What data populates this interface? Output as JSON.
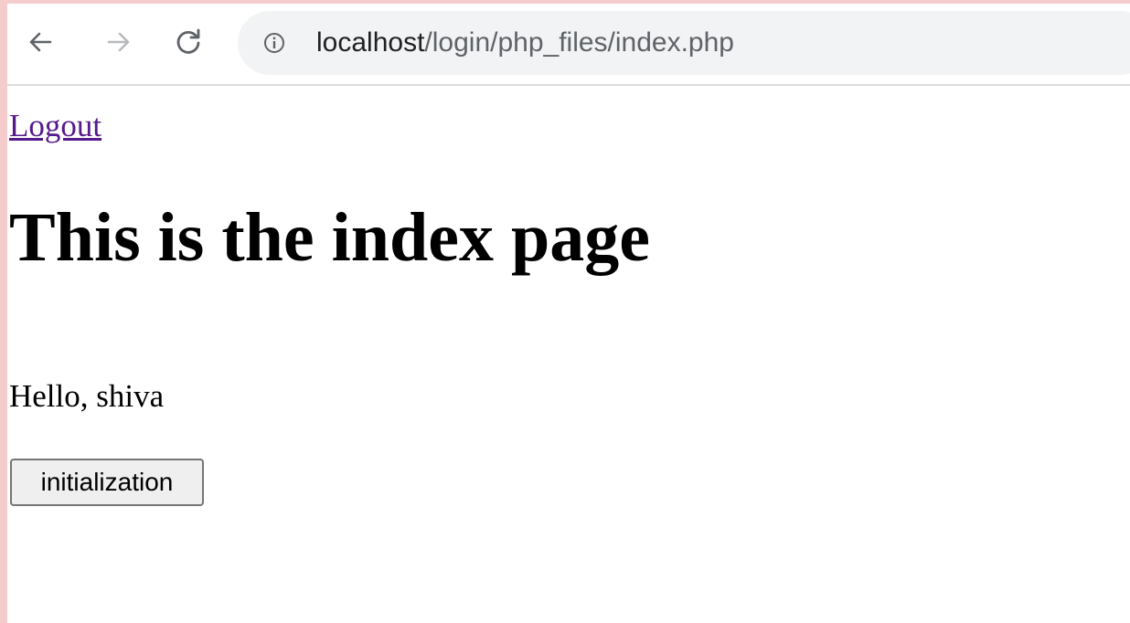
{
  "browser": {
    "url_host": "localhost",
    "url_path": "/login/php_files/index.php",
    "back_icon": "arrow-left-icon",
    "forward_icon": "arrow-right-icon",
    "reload_icon": "reload-icon",
    "site_info_icon": "info-circle-icon"
  },
  "page": {
    "logout_label": "Logout",
    "heading": "This is the index page",
    "greeting": "Hello, shiva",
    "button_label": "initialization"
  },
  "colors": {
    "outer_border": "#f4cccc",
    "link_visited": "#551a8b",
    "omnibox_bg": "#f1f3f4",
    "button_bg": "#efefef"
  }
}
